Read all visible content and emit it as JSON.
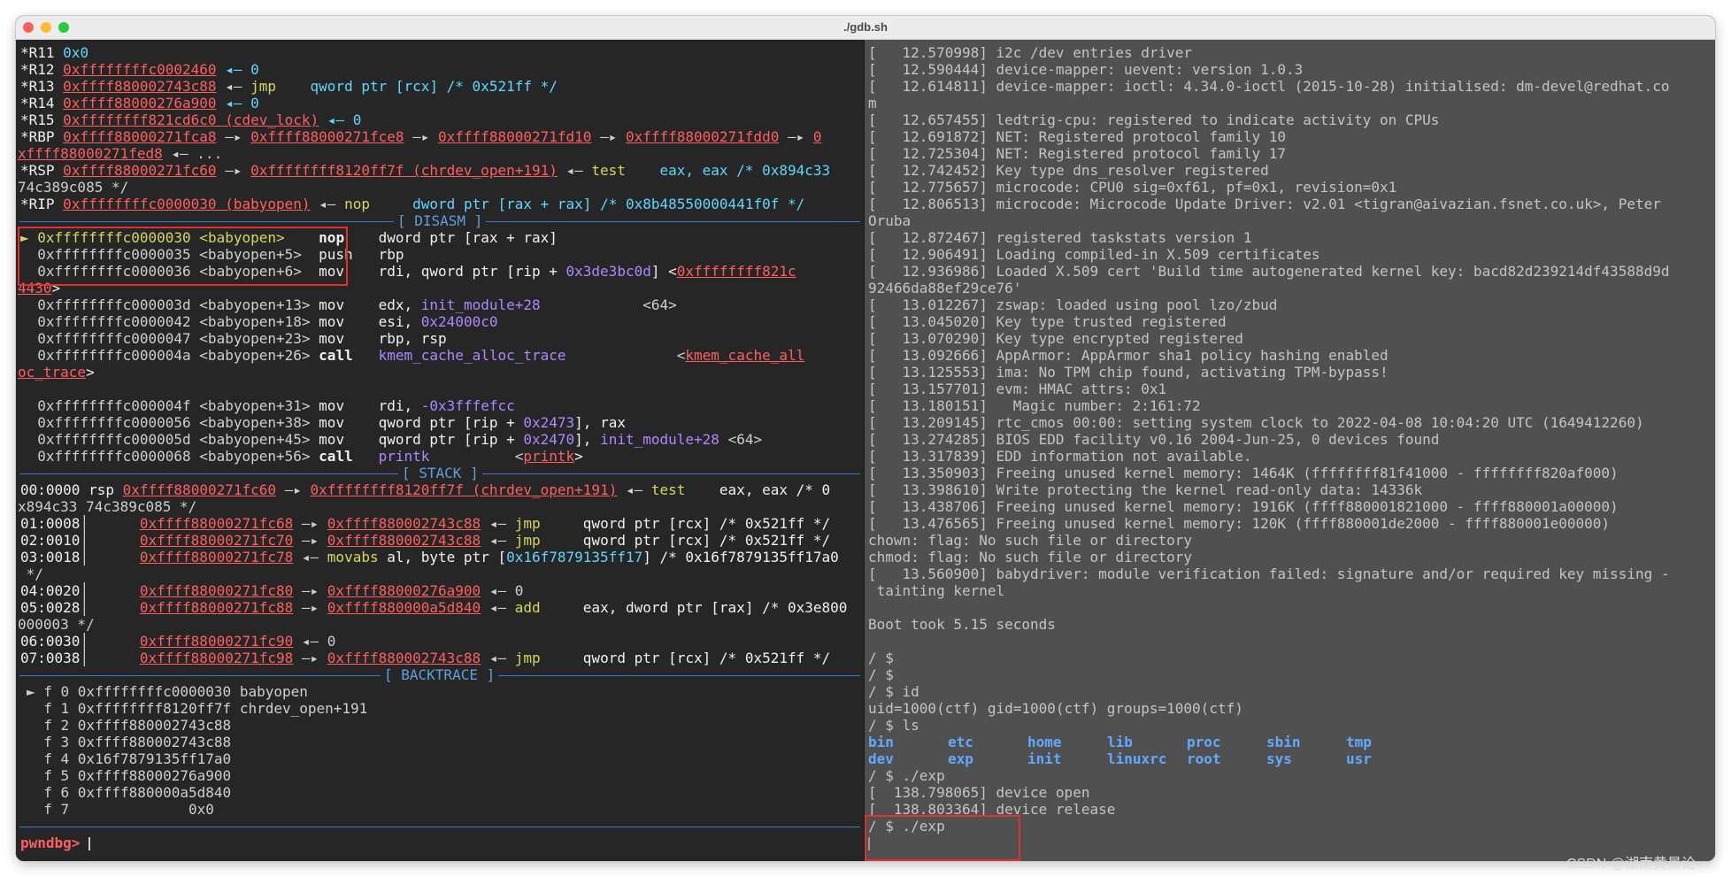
{
  "window": {
    "title": "./gdb.sh",
    "watermark": "CSDN @湖南黄景论"
  },
  "colors": {
    "address": "#ff5f5f",
    "opcode": "#d7d75f",
    "register": "#5fd7ff",
    "symbol": "#af87ff",
    "section_rule": "#3a78c8",
    "highlight_box": "#e23030",
    "left_pane_bg": "#262626",
    "right_pane_bg": "#505050"
  },
  "gdb": {
    "sections": {
      "disasm": "[ DISASM ]",
      "stack": "[ STACK ]",
      "backtrace": "[ BACKTRACE ]"
    },
    "registers": [
      {
        "name": "*R11",
        "rest": "0x0"
      },
      {
        "name": "*R12",
        "addr": "0xffffffffc0002460",
        "rest": " ◂— 0"
      },
      {
        "name": "*R13",
        "addr": "0xffff880002743c88",
        "mid": " ◂— ",
        "op": "jmp",
        "rest": "    qword ptr [rcx] /* 0x521ff */"
      },
      {
        "name": "*R14",
        "addr": "0xffff88000276a900",
        "rest": " ◂— 0"
      },
      {
        "name": "*R15",
        "addr": "0xffffffff821cd6c0 (cdev_lock)",
        "rest": " ◂— 0"
      },
      {
        "name": "*RBP",
        "addr": "0xffff88000271fca8",
        "a2": "0xffff88000271fce8",
        "a3": "0xffff88000271fd10",
        "a4": "0xffff88000271fdd0",
        "a5": "0",
        "cont": "xffff88000271fed8",
        "cont_rest": " ◂— ..."
      },
      {
        "name": "*RSP",
        "addr": "0xffff88000271fc60",
        "a2": "0xffffffff8120ff7f (chrdev_open+191)",
        "op": "test",
        "rest": "eax, eax /* 0x894c33",
        "cont_rest": "74c389c085 */"
      },
      {
        "name": "*RIP",
        "addr": "0xffffffffc0000030 (babyopen)",
        "op": "nop",
        "rest": "dword ptr [rax + rax] /* 0x8b48550000441f0f */"
      }
    ],
    "disasm": [
      {
        "marker": "►",
        "addr": "0xffffffffc0000030",
        "sym": "<babyopen>",
        "op": "nop",
        "args": "dword ptr [rax + rax]"
      },
      {
        "addr": "0xffffffffc0000035",
        "sym": "<babyopen+5>",
        "op": "push",
        "args": "rbp"
      },
      {
        "addr": "0xffffffffc0000036",
        "sym": "<babyopen+6>",
        "op": "mov",
        "args": "rdi, qword ptr [rip + ",
        "imm": "0x3de3bc0d",
        "args2": "] <",
        "target": "0xffffffff821c",
        "target2": "4430",
        "tail2": ">"
      },
      {
        "addr": "0xffffffffc000003d",
        "sym": "<babyopen+13>",
        "op": "mov",
        "args": "edx, ",
        "sym2": "init_module+28",
        "tail": "            <64>"
      },
      {
        "addr": "0xffffffffc0000042",
        "sym": "<babyopen+18>",
        "op": "mov",
        "args": "esi, ",
        "imm": "0x24000c0"
      },
      {
        "addr": "0xffffffffc0000047",
        "sym": "<babyopen+23>",
        "op": "mov",
        "args": "rbp, rsp"
      },
      {
        "addr": "0xffffffffc000004a",
        "sym": "<babyopen+26>",
        "op": "call",
        "args": "",
        "sym2": "kmem_cache_alloc_trace",
        "tail": "             <",
        "target": "kmem_cache_all",
        "target2": "oc_trace",
        "tail2": ">"
      },
      {
        "addr": "0xffffffffc000004f",
        "sym": "<babyopen+31>",
        "op": "mov",
        "args": "rdi, ",
        "imm": "-0x3fffefcc"
      },
      {
        "addr": "0xffffffffc0000056",
        "sym": "<babyopen+38>",
        "op": "mov",
        "args": "qword ptr [rip + ",
        "imm": "0x2473",
        "tail": "], rax"
      },
      {
        "addr": "0xffffffffc000005d",
        "sym": "<babyopen+45>",
        "op": "mov",
        "args": "qword ptr [rip + ",
        "imm": "0x2470",
        "tail": "], ",
        "sym2": "init_module+28",
        "tail3": " <64>"
      },
      {
        "addr": "0xffffffffc0000068",
        "sym": "<babyopen+56>",
        "op": "call",
        "args": "",
        "sym2": "printk",
        "tail": "          <",
        "target": "printk",
        "tail2": ">"
      }
    ],
    "stack": [
      {
        "off": "00:0000",
        "reg": "rsp",
        "addr": "0xffff88000271fc60",
        "arrow": " —▸ ",
        "val": "0xffffffff8120ff7f (chrdev_open+191)",
        "op": "test",
        "rest": "eax, eax /* 0",
        "cont": "x894c33 74c389c085 */"
      },
      {
        "off": "01:0008",
        "addr": "0xffff88000271fc68",
        "arrow": " —▸ ",
        "val": "0xffff880002743c88",
        "op": "jmp",
        "rest": "qword ptr [rcx] /* 0x521ff */"
      },
      {
        "off": "02:0010",
        "addr": "0xffff88000271fc70",
        "arrow": " —▸ ",
        "val": "0xffff880002743c88",
        "op": "jmp",
        "rest": "qword ptr [rcx] /* 0x521ff */"
      },
      {
        "off": "03:0018",
        "addr": "0xffff88000271fc78",
        "op": "movabs",
        "rest": "al, byte ptr [",
        "imm": "0x16f7879135ff17",
        "rest2": "] /* 0x16f7879135ff17a0",
        "cont": "*/"
      },
      {
        "off": "04:0020",
        "addr": "0xffff88000271fc80",
        "arrow": " —▸ ",
        "val": "0xffff88000276a900",
        "rest": " ◂— 0"
      },
      {
        "off": "05:0028",
        "addr": "0xffff88000271fc88",
        "arrow": " —▸ ",
        "val": "0xffff880000a5d840",
        "op": "add",
        "rest": "eax, dword ptr [rax] /* 0x3e800",
        "cont": "000003 */"
      },
      {
        "off": "06:0030",
        "addr": "0xffff88000271fc90",
        "rest": " ◂— 0"
      },
      {
        "off": "07:0038",
        "addr": "0xffff88000271fc98",
        "arrow": " —▸ ",
        "val": "0xffff880002743c88",
        "op": "jmp",
        "rest": "qword ptr [rcx] /* 0x521ff */"
      }
    ],
    "backtrace": [
      "► f 0 0xffffffffc0000030 babyopen",
      "  f 1 0xffffffff8120ff7f chrdev_open+191",
      "  f 2 0xffff880002743c88",
      "  f 3 0xffff880002743c88",
      "  f 4 0x16f7879135ff17a0",
      "  f 5 0xffff88000276a900",
      "  f 6 0xffff880000a5d840",
      "  f 7              0x0"
    ],
    "prompt": "pwndbg>"
  },
  "console": {
    "lines": [
      "[   12.570998] i2c /dev entries driver",
      "[   12.590444] device-mapper: uevent: version 1.0.3",
      "[   12.614811] device-mapper: ioctl: 4.34.0-ioctl (2015-10-28) initialised: dm-devel@redhat.co",
      "m",
      "[   12.657455] ledtrig-cpu: registered to indicate activity on CPUs",
      "[   12.691872] NET: Registered protocol family 10",
      "[   12.725304] NET: Registered protocol family 17",
      "[   12.742452] Key type dns_resolver registered",
      "[   12.775657] microcode: CPU0 sig=0xf61, pf=0x1, revision=0x1",
      "[   12.806513] microcode: Microcode Update Driver: v2.01 <tigran@aivazian.fsnet.co.uk>, Peter",
      "Oruba",
      "[   12.872467] registered taskstats version 1",
      "[   12.906491] Loading compiled-in X.509 certificates",
      "[   12.936986] Loaded X.509 cert 'Build time autogenerated kernel key: bacd82d239214df43588d9d",
      "92466da88ef29ce76'",
      "[   13.012267] zswap: loaded using pool lzo/zbud",
      "[   13.045020] Key type trusted registered",
      "[   13.070290] Key type encrypted registered",
      "[   13.092666] AppArmor: AppArmor sha1 policy hashing enabled",
      "[   13.125553] ima: No TPM chip found, activating TPM-bypass!",
      "[   13.157701] evm: HMAC attrs: 0x1",
      "[   13.180151]   Magic number: 2:161:72",
      "[   13.209145] rtc_cmos 00:00: setting system clock to 2022-04-08 10:04:20 UTC (1649412260)",
      "[   13.274285] BIOS EDD facility v0.16 2004-Jun-25, 0 devices found",
      "[   13.317839] EDD information not available.",
      "[   13.350903] Freeing unused kernel memory: 1464K (ffffffff81f41000 - ffffffff820af000)",
      "[   13.398610] Write protecting the kernel read-only data: 14336k",
      "[   13.438706] Freeing unused kernel memory: 1916K (ffff880001821000 - ffff880001a00000)",
      "[   13.476565] Freeing unused kernel memory: 120K (ffff880001de2000 - ffff880001e00000)",
      "chown: flag: No such file or directory",
      "chmod: flag: No such file or directory",
      "[   13.560900] babydriver: module verification failed: signature and/or required key missing -",
      " tainting kernel",
      "",
      "Boot took 5.15 seconds",
      "",
      "/ $",
      "/ $",
      "/ $ id",
      "uid=1000(ctf) gid=1000(ctf) groups=1000(ctf)",
      "/ $ ls"
    ],
    "ls_rows": [
      [
        "bin",
        "etc",
        "home",
        "lib",
        "proc",
        "sbin",
        "tmp"
      ],
      [
        "dev",
        "exp",
        "init",
        "linuxrc",
        "root",
        "sys",
        "usr"
      ]
    ],
    "tail_lines": [
      "/ $ ./exp",
      "[  138.798065] device open",
      "[  138.803364] device release",
      "/ $ ./exp"
    ]
  }
}
